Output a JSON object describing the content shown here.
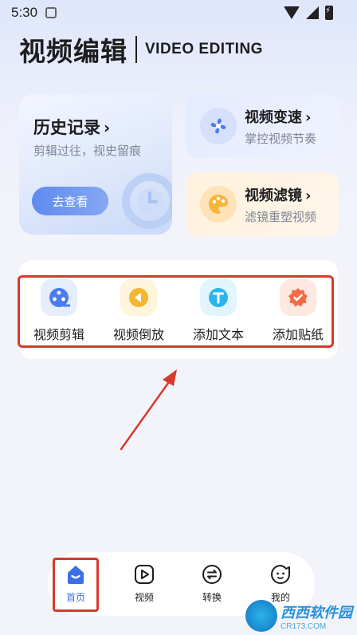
{
  "status": {
    "time": "5:30"
  },
  "header": {
    "title_cn": "视频编辑",
    "title_en": "VIDEO EDITING"
  },
  "history_card": {
    "title": "历史记录",
    "subtitle": "剪辑过往，视史留痕",
    "button": "去查看"
  },
  "speed_card": {
    "title": "视频变速",
    "subtitle": "掌控视频节奏",
    "icon": "fan-icon"
  },
  "filter_card": {
    "title": "视频滤镜",
    "subtitle": "滤镜重塑视频",
    "icon": "palette-icon"
  },
  "tools": [
    {
      "label": "视频剪辑",
      "icon": "film-reel-icon",
      "bg": "#e6edfd",
      "fg": "#4a7cf0"
    },
    {
      "label": "视频倒放",
      "icon": "rewind-icon",
      "bg": "#fff4dc",
      "fg": "#f5b731"
    },
    {
      "label": "添加文本",
      "icon": "text-icon",
      "bg": "#e1f6fc",
      "fg": "#2ab6ec"
    },
    {
      "label": "添加贴纸",
      "icon": "sticker-icon",
      "bg": "#fde8e2",
      "fg": "#f26b45"
    }
  ],
  "tabs": [
    {
      "label": "首页",
      "icon": "home-icon",
      "active": true
    },
    {
      "label": "视频",
      "icon": "play-icon",
      "active": false
    },
    {
      "label": "转换",
      "icon": "convert-icon",
      "active": false
    },
    {
      "label": "我的",
      "icon": "profile-icon",
      "active": false
    }
  ],
  "colors": {
    "accent": "#3b70e8",
    "highlight": "#d63a2c"
  },
  "watermark": {
    "main": "西西软件园",
    "sub": "CR173.COM"
  }
}
